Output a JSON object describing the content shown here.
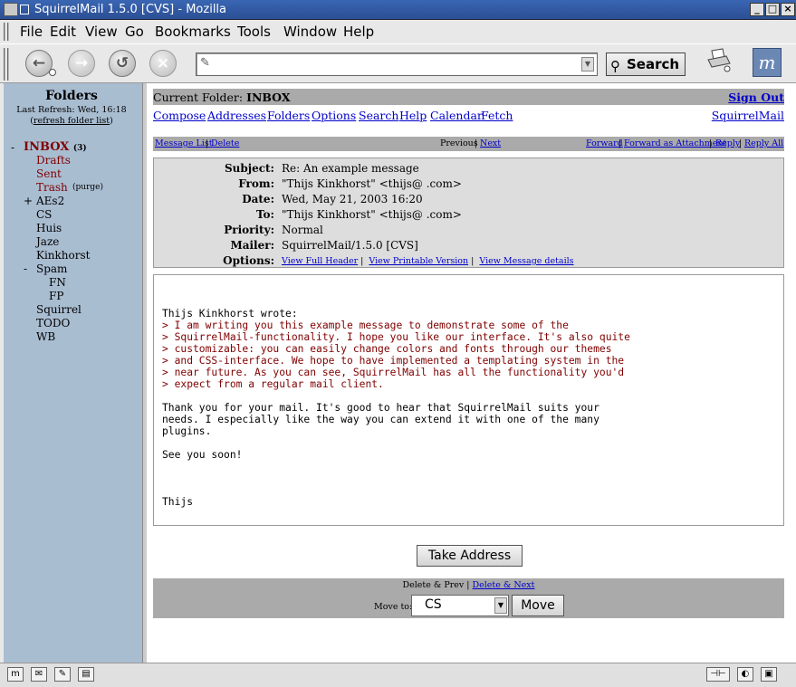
{
  "window": {
    "title": "SquirrelMail 1.5.0 [CVS] - Mozilla"
  },
  "menu": [
    "File",
    "Edit",
    "View",
    "Go",
    "Bookmarks",
    "Tools",
    "Window",
    "Help"
  ],
  "toolbar": {
    "search_label": "Search",
    "url_value": ""
  },
  "sidebar": {
    "header": "Folders",
    "last_refresh": "Last Refresh: Wed, 16:18",
    "refresh_link": "refresh folder list",
    "inbox": {
      "name": "INBOX",
      "count": "(3)"
    },
    "drafts": "Drafts",
    "sent": "Sent",
    "trash": "Trash",
    "purge": "(purge)",
    "folders": [
      "AEs2",
      "CS",
      "Huis",
      "Jaze",
      "Kinkhorst",
      "Spam",
      "FN",
      "FP",
      "Squirrel",
      "TODO",
      "WB"
    ]
  },
  "main": {
    "current_folder_label": "Current Folder:",
    "current_folder": "INBOX",
    "sign_out": "Sign Out",
    "links": [
      "Compose",
      "Addresses",
      "Folders",
      "Options",
      "Search",
      "Help",
      "Calendar",
      "Fetch"
    ],
    "brand_link": "SquirrelMail",
    "nav": {
      "message_list": "Message List",
      "delete": "Delete",
      "previous": "Previous",
      "next": "Next",
      "forward": "Forward",
      "forward_attach": "Forward as Attachment",
      "reply": "Reply",
      "reply_all": "Reply All"
    },
    "headers": {
      "subject_label": "Subject:",
      "subject": "Re: An example message",
      "from_label": "From:",
      "from": "\"Thijs Kinkhorst\" <thijs@            .com>",
      "date_label": "Date:",
      "date": "Wed, May 21, 2003 16:20",
      "to_label": "To:",
      "to": "\"Thijs Kinkhorst\" <thijs@            .com>",
      "priority_label": "Priority:",
      "priority": "Normal",
      "mailer_label": "Mailer:",
      "mailer": "SquirrelMail/1.5.0 [CVS]",
      "options_label": "Options:",
      "view_full_header": "View Full Header",
      "view_printable": "View Printable Version",
      "view_details": "View Message details"
    },
    "body": {
      "intro": "Thijs Kinkhorst wrote:",
      "quoted": [
        "> I am writing you this example message to demonstrate some of the",
        "> SquirrelMail-functionality. I hope you like our interface. It's also quite",
        "> customizable: you can easily change colors and fonts through our themes",
        "> and CSS-interface. We hope to have implemented a templating system in the",
        "> near future. As you can see, SquirrelMail has all the functionality you'd",
        "> expect from a regular mail client."
      ],
      "reply": [
        "Thank you for your mail. It's good to hear that SquirrelMail suits your",
        "needs. I especially like the way you can extend it with one of the many",
        "plugins."
      ],
      "closing": "See you soon!",
      "signature": "Thijs"
    },
    "take_address": "Take Address",
    "bottom": {
      "delete_prev": "Delete & Prev",
      "delete_next": "Delete & Next",
      "move_to_label": "Move to:",
      "move_target": "CS",
      "move_button": "Move"
    }
  }
}
